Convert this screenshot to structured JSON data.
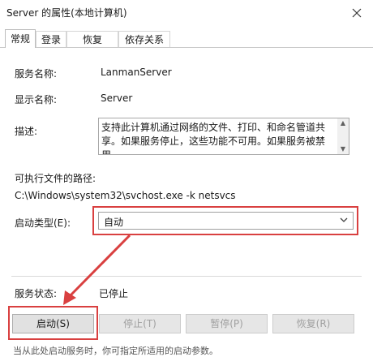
{
  "window": {
    "title": "Server 的属性(本地计算机)",
    "close_icon": "close-icon"
  },
  "tabs": [
    {
      "label": "常规",
      "active": true
    },
    {
      "label": "登录",
      "active": false
    },
    {
      "label": "恢复",
      "active": false
    },
    {
      "label": "依存关系",
      "active": false
    }
  ],
  "general": {
    "service_name_label": "服务名称:",
    "service_name_value": "LanmanServer",
    "display_name_label": "显示名称:",
    "display_name_value": "Server",
    "description_label": "描述:",
    "description_text": "支持此计算机通过网络的文件、打印、和命名管道共享。如果服务停止，这些功能不可用。如果服务被禁用，",
    "exe_path_label": "可执行文件的路径:",
    "exe_path_value": "C:\\Windows\\system32\\svchost.exe -k netsvcs",
    "startup_type_label": "启动类型(E):",
    "startup_type_value": "自动",
    "service_status_label": "服务状态:",
    "service_status_value": "已停止"
  },
  "buttons": {
    "start": "启动(S)",
    "stop": "停止(T)",
    "pause": "暂停(P)",
    "resume": "恢复(R)"
  },
  "footer": {
    "partial_text": "当从此处启动服务时，你可指定所适用的启动参数。"
  },
  "colors": {
    "highlight_red": "#d94040"
  }
}
